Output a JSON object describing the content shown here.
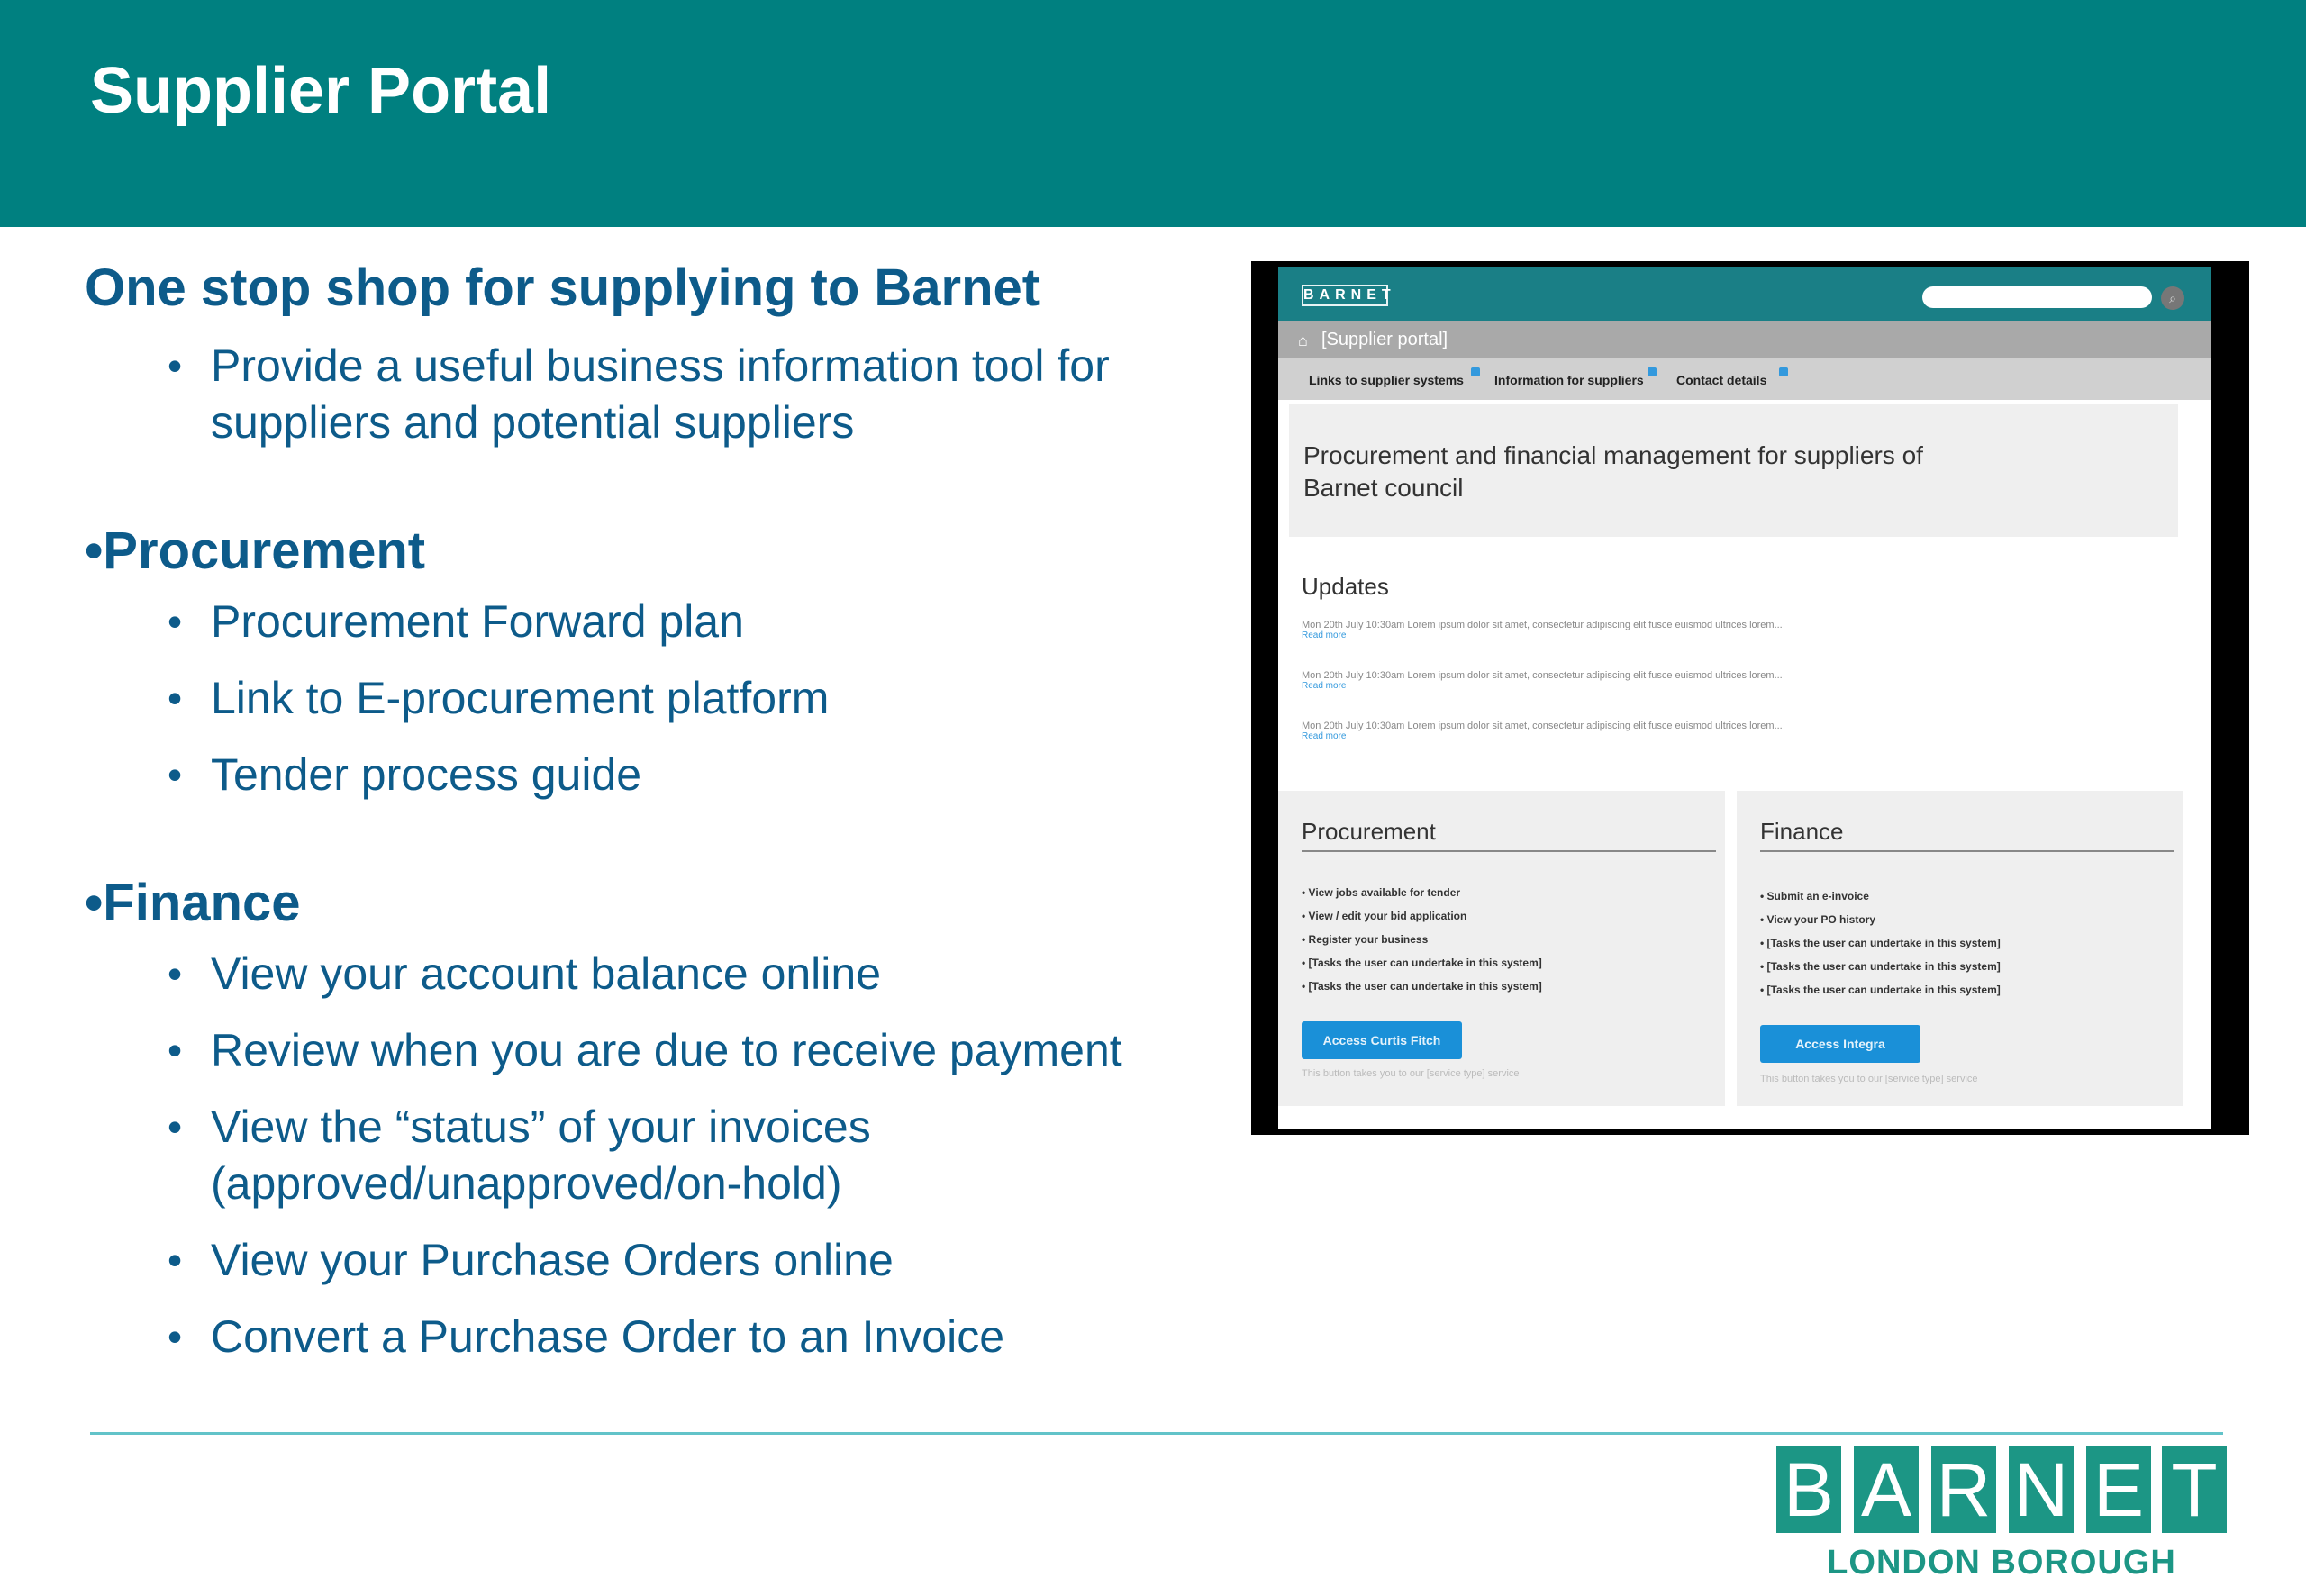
{
  "header": {
    "title": "Supplier Portal"
  },
  "content": {
    "headline": "One stop shop for supplying to Barnet",
    "intro_bullets": [
      "Provide a useful business information tool for suppliers and potential suppliers"
    ],
    "procurement": {
      "heading": "•Procurement",
      "bullets": [
        "Procurement Forward plan",
        "Link to E-procurement platform",
        "Tender process guide"
      ]
    },
    "finance": {
      "heading": "•Finance",
      "bullets": [
        "View your account balance online",
        "Review when you are due to receive payment",
        "View the “status” of your invoices (approved/unapproved/on-hold)",
        "View your Purchase Orders online",
        "Convert a Purchase Order to an Invoice"
      ]
    }
  },
  "screenshot": {
    "logo": "BARNET",
    "breadcrumb": "[Supplier portal]",
    "nav": [
      "Links to supplier systems",
      "Information for suppliers",
      "Contact details"
    ],
    "hero": "Procurement and financial management for suppliers of Barnet council",
    "updates_title": "Updates",
    "updates": [
      {
        "text": "Mon 20th July 10:30am Lorem ipsum dolor sit amet, consectetur adipiscing elit fusce euismod ultrices lorem...",
        "more": "Read more"
      },
      {
        "text": "Mon 20th July 10:30am Lorem ipsum dolor sit amet, consectetur adipiscing elit fusce euismod ultrices lorem...",
        "more": "Read more"
      },
      {
        "text": "Mon 20th July 10:30am Lorem ipsum dolor sit amet, consectetur adipiscing elit fusce euismod ultrices lorem...",
        "more": "Read more"
      }
    ],
    "procurement_card": {
      "title": "Procurement",
      "items": [
        "• View jobs available for tender",
        "• View / edit your bid application",
        "• Register your business",
        "• [Tasks the user can undertake in this system]",
        "• [Tasks the user can undertake in this system]"
      ],
      "button": "Access Curtis Fitch",
      "note": "This button takes you to our [service type] service"
    },
    "finance_card": {
      "title": "Finance",
      "items": [
        "• Submit an e-invoice",
        "• View your PO history",
        "• [Tasks the user can undertake in this system]",
        "• [Tasks the user can undertake in this system]",
        "• [Tasks the user can undertake in this system]"
      ],
      "button": "Access Integra",
      "note": "This button takes you to our [service type] service"
    }
  },
  "logo": {
    "letters": [
      "B",
      "A",
      "R",
      "N",
      "E",
      "T"
    ],
    "subtitle": "LONDON BOROUGH"
  },
  "colors": {
    "header": "#008080",
    "text": "#0d5b8a",
    "rule": "#62c3c9",
    "logo": "#1c9685"
  }
}
